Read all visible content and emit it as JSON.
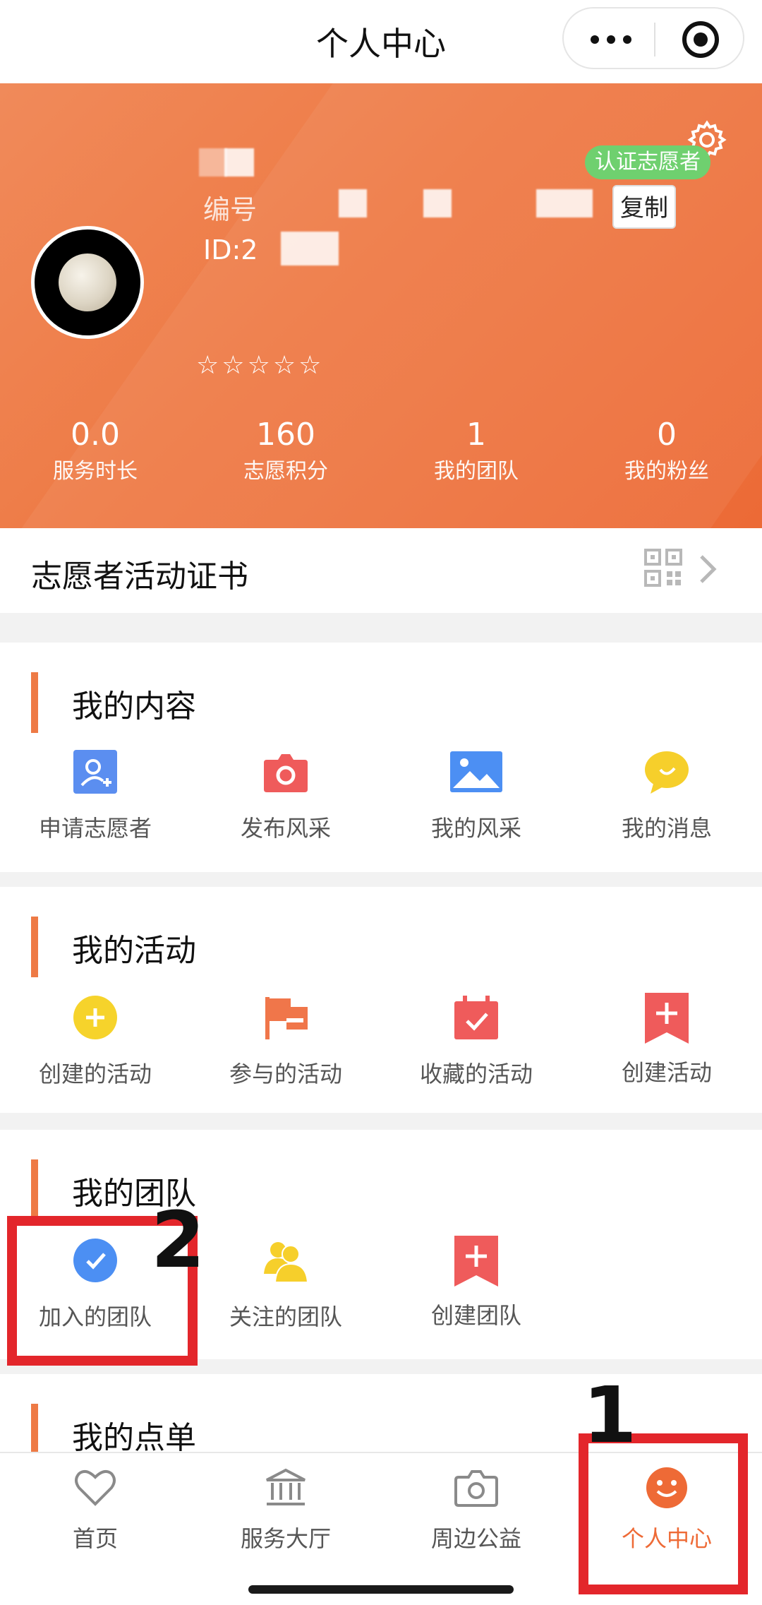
{
  "navbar": {
    "title": "个人中心"
  },
  "profile": {
    "name_prefix": "编号",
    "id_prefix": "ID:2",
    "badge": "认证志愿者",
    "copy_label": "复制",
    "stars": [
      "☆",
      "☆",
      "☆",
      "☆",
      "☆"
    ]
  },
  "stats": [
    {
      "value": "0.0",
      "label": "服务时长"
    },
    {
      "value": "160",
      "label": "志愿积分"
    },
    {
      "value": "1",
      "label": "我的团队"
    },
    {
      "value": "0",
      "label": "我的粉丝"
    }
  ],
  "certificate": {
    "title": "志愿者活动证书",
    "icon": "qr-code-icon"
  },
  "sections": {
    "content": {
      "title": "我的内容",
      "items": [
        {
          "label": "申请志愿者",
          "icon": "apply-volunteer-icon",
          "color": "#5b8ef0"
        },
        {
          "label": "发布风采",
          "icon": "camera-icon",
          "color": "#ef5b5b"
        },
        {
          "label": "我的风采",
          "icon": "picture-icon",
          "color": "#4c8ff3"
        },
        {
          "label": "我的消息",
          "icon": "message-icon",
          "color": "#f6cf2b"
        }
      ]
    },
    "activities": {
      "title": "我的活动",
      "items": [
        {
          "label": "创建的活动",
          "icon": "plus-circle-icon",
          "color": "#f6d32b"
        },
        {
          "label": "参与的活动",
          "icon": "flag-icon",
          "color": "#f0764a"
        },
        {
          "label": "收藏的活动",
          "icon": "calendar-check-icon",
          "color": "#ef5b5b"
        },
        {
          "label": "创建活动",
          "icon": "bookmark-plus-icon",
          "color": "#ef5b5b"
        }
      ]
    },
    "teams": {
      "title": "我的团队",
      "items": [
        {
          "label": "加入的团队",
          "icon": "check-circle-icon",
          "color": "#4c8ff3"
        },
        {
          "label": "关注的团队",
          "icon": "people-icon",
          "color": "#f6cf2b"
        },
        {
          "label": "创建团队",
          "icon": "bookmark-plus-icon",
          "color": "#ef5b5b"
        }
      ]
    },
    "orders": {
      "title": "我的点单"
    }
  },
  "tabbar": [
    {
      "label": "首页",
      "icon": "heart-icon"
    },
    {
      "label": "服务大厅",
      "icon": "bank-icon"
    },
    {
      "label": "周边公益",
      "icon": "camera-outline-icon"
    },
    {
      "label": "个人中心",
      "icon": "smile-icon",
      "active": true,
      "color": "#ee6a36"
    }
  ],
  "annotations": {
    "box1_number": "1",
    "box2_number": "2"
  }
}
